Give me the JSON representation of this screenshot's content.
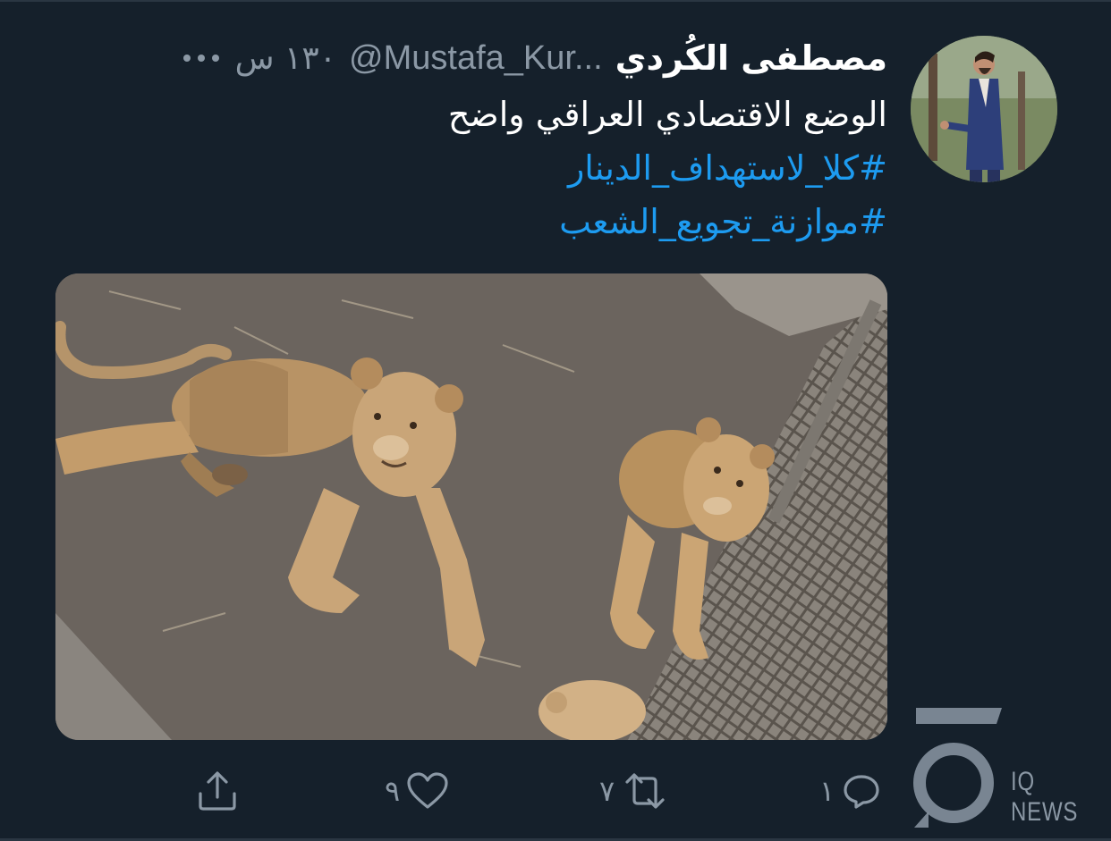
{
  "tweet": {
    "display_name": "مصطفى الكُردي",
    "handle": "@Mustafa_Kur...",
    "time": "١٣٠ س",
    "text_line": "الوضع الاقتصادي العراقي واضح",
    "hashtags": [
      "#كلا_لاستهداف_الدينار",
      "#موازنة_تجويع_الشعب"
    ]
  },
  "actions": {
    "reply_count": "١",
    "retweet_count": "٧",
    "like_count": "٩"
  },
  "watermark": {
    "text": "IQ NEWS"
  },
  "icons": {
    "more": "more-horizontal-icon",
    "reply": "reply-icon",
    "retweet": "retweet-icon",
    "like": "heart-icon",
    "share": "share-icon"
  },
  "colors": {
    "background": "#15202b",
    "secondary_text": "#8b98a5",
    "link": "#1d9bf0"
  }
}
